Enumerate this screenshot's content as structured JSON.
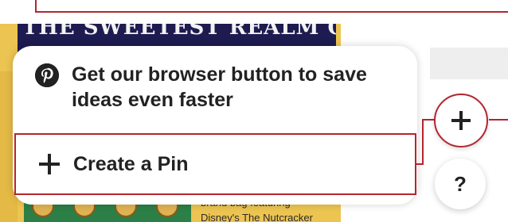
{
  "background_pin": {
    "banner_text": "THE SWEETEST REALM OF GIFTING",
    "caption_line1": "brand bag featuring",
    "caption_line2": "Disney's The Nutcracker"
  },
  "menu": {
    "browser_button_label": "Get our browser button to save ideas even faster",
    "create_pin_label": "Create a Pin"
  },
  "floating_buttons": {
    "help_label": "?"
  },
  "colors": {
    "callout_red": "#b3262d",
    "text_dark": "#222222",
    "banner_navy": "#1d1b4f",
    "pin_gold": "#ecc451"
  },
  "icons": [
    "pinterest-logo-icon",
    "plus-icon",
    "help-icon"
  ]
}
